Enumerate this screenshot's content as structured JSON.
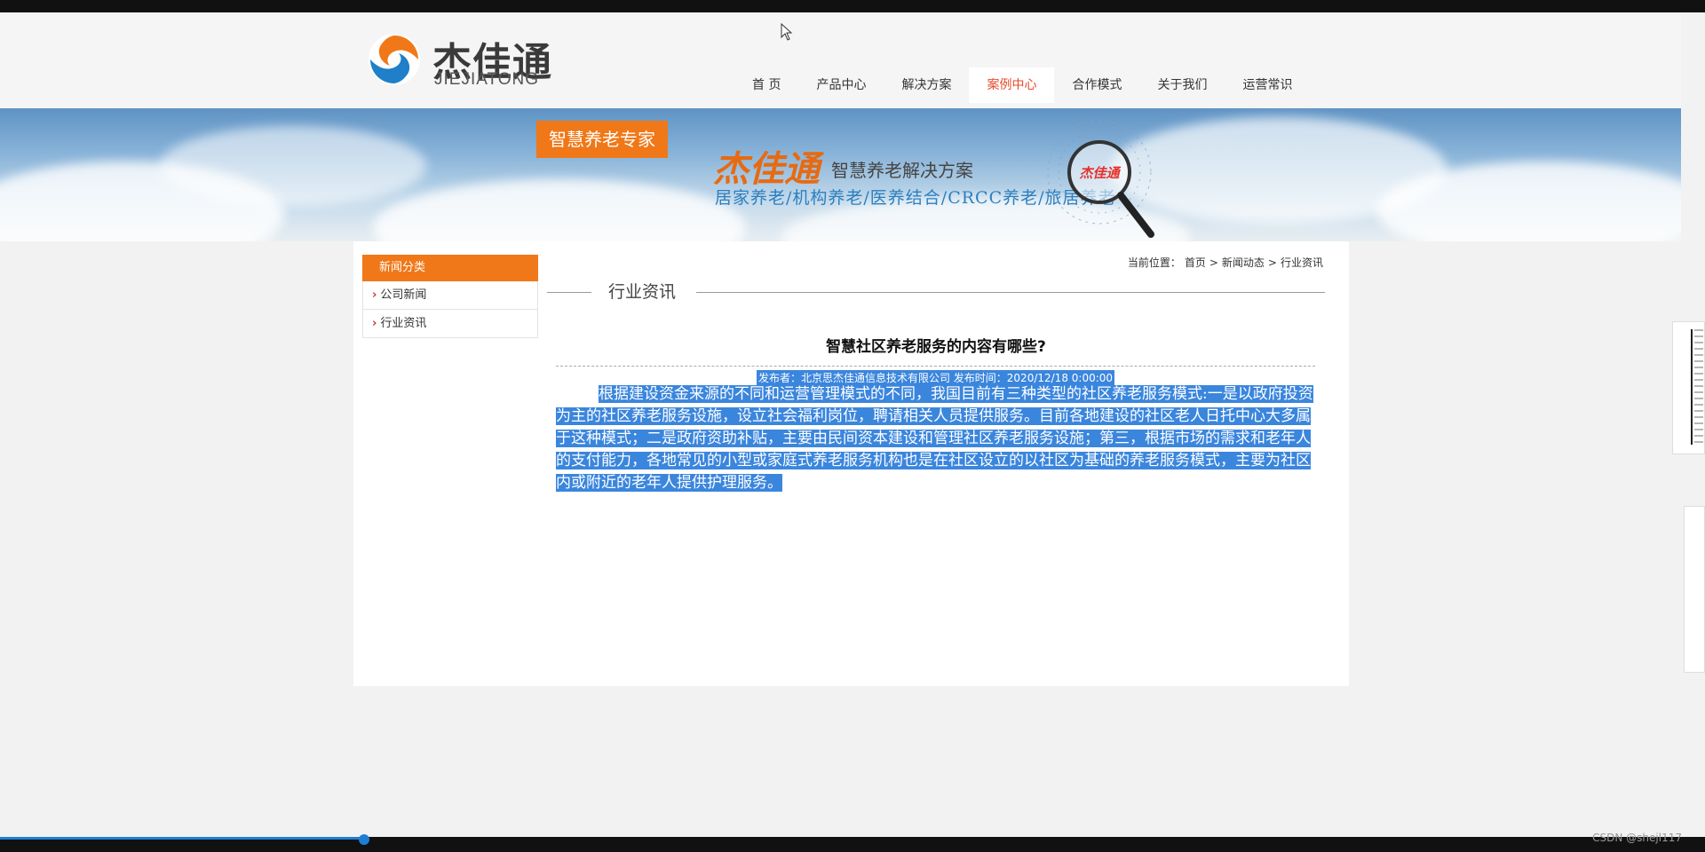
{
  "logo": {
    "cn": "杰佳通",
    "en": "JIEJIATONG"
  },
  "nav": [
    {
      "label": "首 页",
      "active": false
    },
    {
      "label": "产品中心",
      "active": false
    },
    {
      "label": "解决方案",
      "active": false
    },
    {
      "label": "案例中心",
      "active": true
    },
    {
      "label": "合作模式",
      "active": false
    },
    {
      "label": "关于我们",
      "active": false
    },
    {
      "label": "运营常识",
      "active": false
    }
  ],
  "banner": {
    "badge": "智慧养老专家",
    "brand": "杰佳通",
    "subtitle": "智慧养老解决方案",
    "categories": "居家养老/机构养老/医养结合/CRCC养老/旅居养老",
    "magnifier_text": "杰佳通"
  },
  "sidebar": {
    "title": "新闻分类",
    "items": [
      {
        "label": "公司新闻"
      },
      {
        "label": "行业资讯"
      }
    ]
  },
  "breadcrumb": {
    "prefix": "当前位置：",
    "items": [
      "首页",
      "新闻动态",
      "行业资讯"
    ],
    "separator": ">"
  },
  "section": {
    "title": "行业资讯"
  },
  "article": {
    "title": "智慧社区养老服务的内容有哪些?",
    "meta": "发布者：北京思杰佳通信息技术有限公司  发布时间：2020/12/18 0:00:00",
    "body": "根据建设资金来源的不同和运营管理模式的不同，我国目前有三种类型的社区养老服务模式:一是以政府投资为主的社区养老服务设施，设立社会福利岗位，聘请相关人员提供服务。目前各地建设的社区老人日托中心大多属于这种模式；二是政府资助补贴，主要由民间资本建设和管理社区养老服务设施；第三，根据市场的需求和老年人的支付能力，各地常见的小型或家庭式养老服务机构也是在社区设立的以社区为基础的养老服务模式，主要为社区内或附近的老年人提供护理服务。"
  },
  "watermark": "CSDN @shejl117",
  "colors": {
    "accent": "#f07818",
    "nav_active": "#e54b2a",
    "selection": "#3b86dd"
  }
}
